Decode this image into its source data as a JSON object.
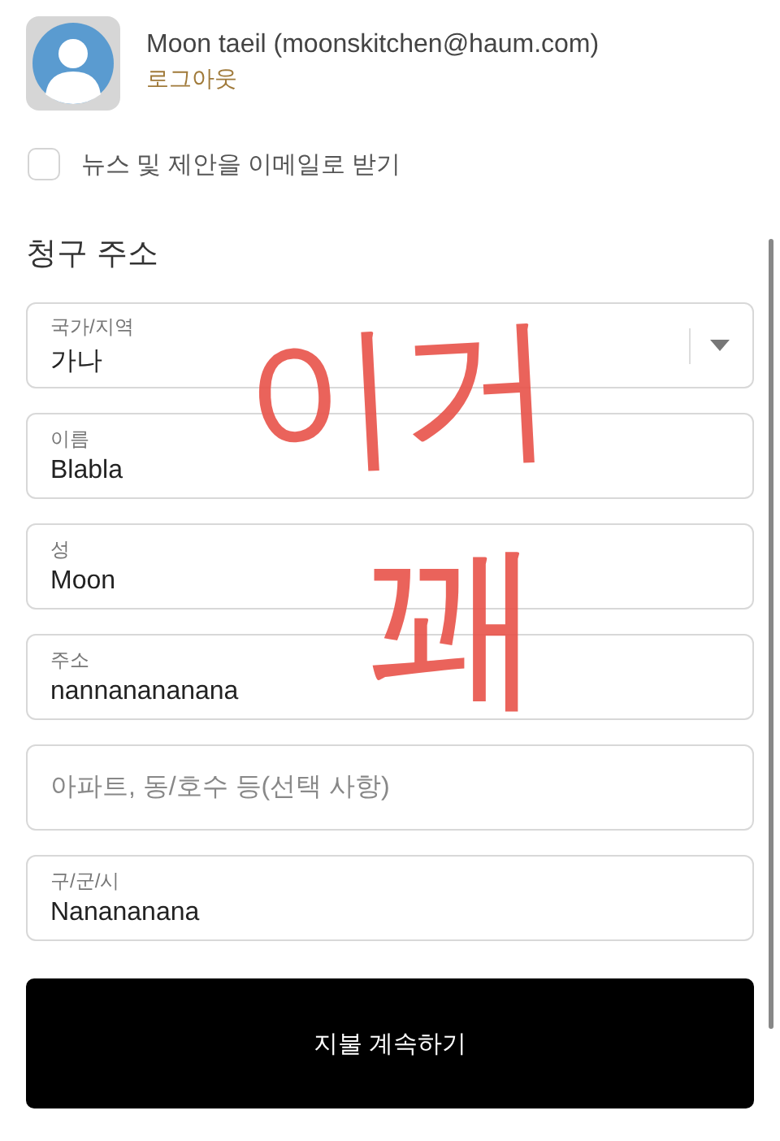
{
  "account": {
    "name": "Moon taeil (moonskitchen@haum.com)",
    "logout": "로그아웃"
  },
  "newsletter": {
    "label": "뉴스 및 제안을 이메일로 받기",
    "checked": false
  },
  "billing": {
    "title": "청구 주소",
    "fields": [
      {
        "kind": "select",
        "label": "국가/지역",
        "value": "가나"
      },
      {
        "kind": "text",
        "label": "이름",
        "value": "Blabla"
      },
      {
        "kind": "text",
        "label": "성",
        "value": "Moon"
      },
      {
        "kind": "text",
        "label": "주소",
        "value": "nannanananana"
      },
      {
        "kind": "text",
        "placeholder": "아파트, 동/호수 등(선택 사항)"
      },
      {
        "kind": "text",
        "label": "구/군/시",
        "value": "Nanananana"
      }
    ]
  },
  "continue_button": "지불 계속하기",
  "annotation": [
    "이거",
    "꽤"
  ]
}
